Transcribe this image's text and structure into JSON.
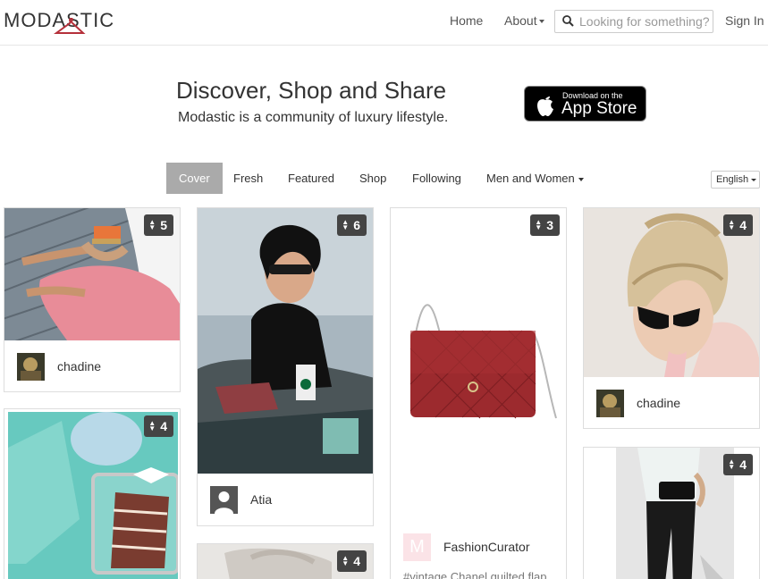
{
  "header": {
    "logo": "MODASTIC",
    "nav": {
      "home": "Home",
      "about": "About",
      "sign_in": "Sign In"
    },
    "search": {
      "placeholder": "Looking for something?"
    }
  },
  "hero": {
    "title": "Discover, Shop and Share",
    "subtitle": "Modastic is a community of luxury lifestyle.",
    "appstore": {
      "small": "Download on the",
      "big": "App Store"
    }
  },
  "tabs": [
    {
      "label": "Cover",
      "active": true
    },
    {
      "label": "Fresh"
    },
    {
      "label": "Featured"
    },
    {
      "label": "Shop"
    },
    {
      "label": "Following"
    },
    {
      "label": "Men and Women"
    }
  ],
  "language": "English",
  "cards": [
    {
      "count": "5",
      "user": "chadine"
    },
    {
      "count": "6",
      "user": "Atia"
    },
    {
      "count": "3",
      "user": "FashionCurator",
      "avatar_letter": "M",
      "caption": "#vintage Chanel quilted flap"
    },
    {
      "count": "4",
      "user": "chadine"
    },
    {
      "count": "4"
    },
    {
      "count": "4"
    },
    {
      "count": "4"
    }
  ],
  "colors": {
    "active_tab": "#aaaaaa",
    "badge": "#444444",
    "logo_accent": "#b5303a"
  }
}
